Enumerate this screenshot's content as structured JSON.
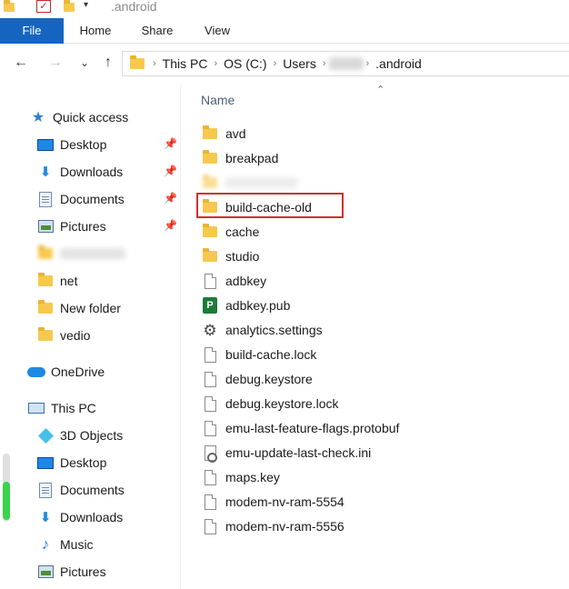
{
  "window": {
    "title": ".android"
  },
  "ribbon": {
    "tabs": [
      "File",
      "Home",
      "Share",
      "View"
    ]
  },
  "nav_buttons": {
    "back": "←",
    "forward": "→",
    "recent": "⌄",
    "up": "↑"
  },
  "address": {
    "crumbs": [
      "This PC",
      "OS (C:)",
      "Users",
      "",
      ".android"
    ]
  },
  "navpane": {
    "items": [
      {
        "label": "Quick access",
        "icon": "star-icon",
        "pinned": false,
        "level": 0
      },
      {
        "label": "Desktop",
        "icon": "desktop-icon",
        "pinned": true,
        "level": 1
      },
      {
        "label": "Downloads",
        "icon": "downloads-icon",
        "pinned": true,
        "level": 1
      },
      {
        "label": "Documents",
        "icon": "documents-icon",
        "pinned": true,
        "level": 1
      },
      {
        "label": "Pictures",
        "icon": "pictures-icon",
        "pinned": true,
        "level": 1
      },
      {
        "label": "",
        "icon": "folder-icon",
        "pinned": false,
        "level": 1,
        "blurred": true
      },
      {
        "label": "net",
        "icon": "folder-icon",
        "pinned": false,
        "level": 1
      },
      {
        "label": "New folder",
        "icon": "folder-icon",
        "pinned": false,
        "level": 1
      },
      {
        "label": "vedio",
        "icon": "folder-icon",
        "pinned": false,
        "level": 1
      },
      {
        "label": "OneDrive",
        "icon": "onedrive-icon",
        "pinned": false,
        "level": 0
      },
      {
        "label": "This PC",
        "icon": "this-pc-icon",
        "pinned": false,
        "level": 0
      },
      {
        "label": "3D Objects",
        "icon": "3d-objects-icon",
        "pinned": false,
        "level": 1
      },
      {
        "label": "Desktop",
        "icon": "desktop-icon",
        "pinned": false,
        "level": 1
      },
      {
        "label": "Documents",
        "icon": "documents-icon",
        "pinned": false,
        "level": 1
      },
      {
        "label": "Downloads",
        "icon": "downloads-icon",
        "pinned": false,
        "level": 1
      },
      {
        "label": "Music",
        "icon": "music-icon",
        "pinned": false,
        "level": 1
      },
      {
        "label": "Pictures",
        "icon": "pictures-icon",
        "pinned": false,
        "level": 1
      }
    ]
  },
  "filelist": {
    "column_name": "Name",
    "highlight_color": "#d32f2f",
    "items": [
      {
        "name": "avd",
        "type": "folder"
      },
      {
        "name": "breakpad",
        "type": "folder"
      },
      {
        "name": "",
        "type": "folder",
        "blurred": true
      },
      {
        "name": "build-cache-old",
        "type": "folder",
        "highlighted": true
      },
      {
        "name": "cache",
        "type": "folder"
      },
      {
        "name": "studio",
        "type": "folder"
      },
      {
        "name": "adbkey",
        "type": "file"
      },
      {
        "name": "adbkey.pub",
        "type": "publisher"
      },
      {
        "name": "analytics.settings",
        "type": "settings"
      },
      {
        "name": "build-cache.lock",
        "type": "file"
      },
      {
        "name": "debug.keystore",
        "type": "file"
      },
      {
        "name": "debug.keystore.lock",
        "type": "file"
      },
      {
        "name": "emu-last-feature-flags.protobuf",
        "type": "file"
      },
      {
        "name": "emu-update-last-check.ini",
        "type": "ini"
      },
      {
        "name": "maps.key",
        "type": "file"
      },
      {
        "name": "modem-nv-ram-5554",
        "type": "file"
      },
      {
        "name": "modem-nv-ram-5556",
        "type": "file"
      }
    ]
  }
}
